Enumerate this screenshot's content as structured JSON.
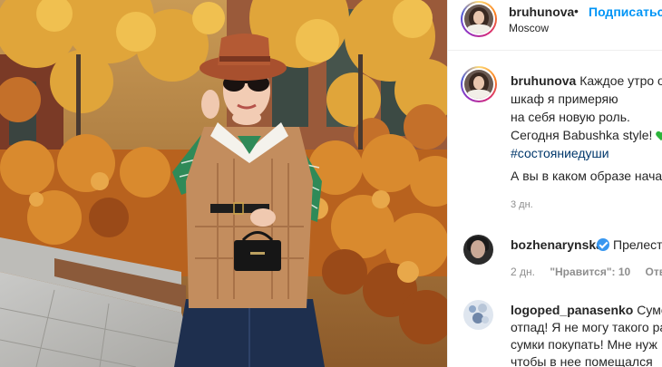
{
  "header": {
    "username": "bruhunova",
    "separator": "•",
    "follow_label": "Подписаться",
    "location": "Moscow"
  },
  "caption": {
    "username": "bruhunova",
    "line1": "Каждое утро о",
    "line2": "шкаф я примеряю",
    "line3": "на себя новую роль.",
    "line4": "Сегодня Babushka style!",
    "hashtag": "#состояниедуши",
    "question": "А вы в каком образе нача",
    "time": "3 дн."
  },
  "comments": [
    {
      "username": "bozhenarynska",
      "text": "Прелест",
      "time": "2 дн.",
      "likes": "\"Нравится\": 10",
      "reply_label": "Ответ"
    },
    {
      "username": "logoped_panasenko",
      "text_line1": "Сумо",
      "text_line2": "отпад! Я не могу такого ра",
      "text_line3": "сумки покупать! Мне нуж",
      "text_line4": "чтобы в нее помещался"
    }
  ],
  "icons": {
    "verified": "verified-badge-icon",
    "heart": "green-heart-emoji-icon"
  },
  "colors": {
    "link_blue": "#0095f6",
    "hashtag": "#00376b",
    "verified": "#3897f0",
    "muted": "#8e8e8e"
  }
}
